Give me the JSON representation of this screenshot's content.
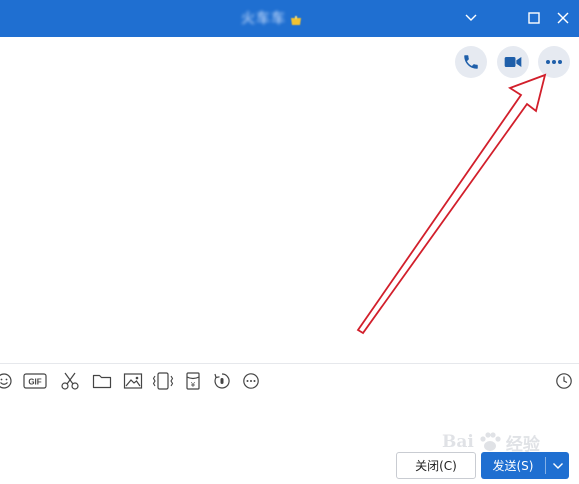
{
  "titlebar": {
    "title": "火车车",
    "badge_color": "#f2c230",
    "controls": {
      "minimize": "chevron-down-icon",
      "maximize": "square-icon",
      "close": "close-icon"
    }
  },
  "header_actions": [
    {
      "name": "voice-call-button",
      "icon": "phone-icon"
    },
    {
      "name": "video-call-button",
      "icon": "video-camera-icon"
    },
    {
      "name": "more-options-button",
      "icon": "ellipsis-icon"
    }
  ],
  "toolbar": {
    "items": [
      "emoji-icon",
      "gif-icon",
      "scissors-icon",
      "folder-icon",
      "image-icon",
      "shake-window-icon",
      "red-packet-icon",
      "voice-message-icon",
      "more-icon",
      "history-clock-icon"
    ],
    "gif_label": "GIF",
    "red_packet_symbol": "¥"
  },
  "buttons": {
    "close_label": "关闭(C)",
    "send_label": "发送(S)"
  },
  "watermark": {
    "text": "Bai",
    "suffix": "经验"
  },
  "colors": {
    "brand": "#1f6fd1",
    "icon": "#1f5faa",
    "action_bg": "#e6eaf1",
    "annotation_arrow": "#d21f2b"
  }
}
